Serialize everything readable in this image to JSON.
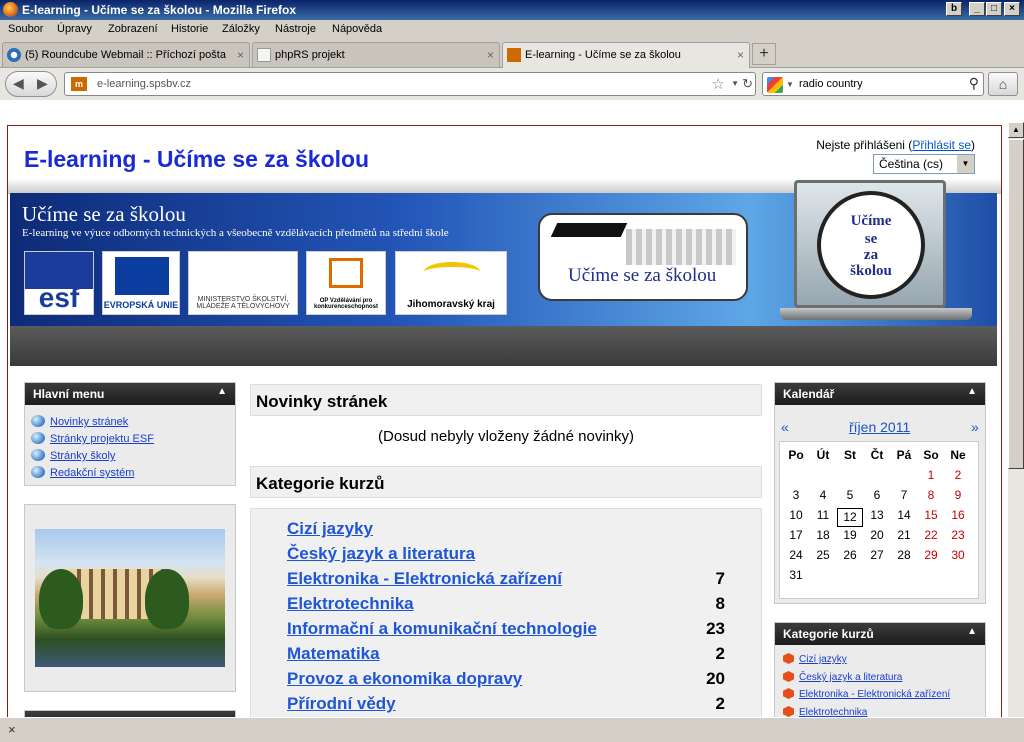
{
  "window": {
    "title": "E-learning - Učíme se za školou - Mozilla Firefox"
  },
  "menubar": [
    "Soubor",
    "Úpravy",
    "Zobrazení",
    "Historie",
    "Záložky",
    "Nástroje",
    "Nápověda"
  ],
  "tabs": [
    {
      "label": "(5) Roundcube Webmail :: Příchozí pošta",
      "close": "×"
    },
    {
      "label": "phpRS projekt",
      "close": "×"
    },
    {
      "label": "E-learning - Učíme se za školou",
      "close": "×"
    }
  ],
  "newtab": "+",
  "navbar": {
    "site_badge": "m",
    "url": "e-learning.spsbv.cz",
    "search_query": "radio country"
  },
  "page": {
    "site_title": "E-learning - Učíme se za školou",
    "login_text": "Nejste přihlášeni (",
    "login_link": "Přihlásit se",
    "login_end": ")",
    "language": "Čeština (cs)"
  },
  "banner": {
    "title": "Učíme se za školou",
    "subtitle": "E-learning ve výuce odborných technických a všeobecně vzdělávacích předmětů na střední škole",
    "logos": [
      "esf",
      "EVROPSKÁ UNIE",
      "MINISTERSTVO ŠKOLSTVÍ, MLÁDEŽE A TĚLOVÝCHOVY",
      "OP Vzdělávání pro konkurenceschopnost",
      "Jihomoravský kraj"
    ],
    "box_text": "Učíme se za školou",
    "clock_text": [
      "Učíme",
      "se",
      "za",
      "školou"
    ]
  },
  "main_menu": {
    "title": "Hlavní menu",
    "items": [
      "Novinky stránek",
      "Stránky projektu ESF",
      "Stránky školy",
      "Redakční systém"
    ]
  },
  "news": {
    "title": "Novinky stránek",
    "message": "(Dosud nebyly vloženy žádné novinky)"
  },
  "categories": {
    "title": "Kategorie kurzů",
    "items": [
      {
        "name": "Cizí jazyky",
        "count": ""
      },
      {
        "name": "Český jazyk a literatura",
        "count": ""
      },
      {
        "name": "Elektronika - Elektronická zařízení",
        "count": "7"
      },
      {
        "name": "Elektrotechnika",
        "count": "8"
      },
      {
        "name": "Informační a komunikační technologie",
        "count": "23"
      },
      {
        "name": "Matematika",
        "count": "2"
      },
      {
        "name": "Provoz a ekonomika dopravy",
        "count": "20"
      },
      {
        "name": "Přírodní vědy",
        "count": "2"
      }
    ]
  },
  "calendar": {
    "title": "Kalendář",
    "month": "říjen 2011",
    "prev": "«",
    "next": "»",
    "weekdays": [
      "Po",
      "Út",
      "St",
      "Čt",
      "Pá",
      "So",
      "Ne"
    ],
    "today": "12"
  },
  "side_categories": {
    "title": "Kategorie kurzů",
    "items": [
      "Cizí jazyky",
      "Český jazyk a literatura",
      "Elektronika - Elektronická zařízení",
      "Elektrotechnika"
    ]
  },
  "colors": {
    "accent": "#1a2bd6",
    "link": "#1e56d6",
    "weekend": "#cc0000",
    "border": "#8b1c1c"
  }
}
